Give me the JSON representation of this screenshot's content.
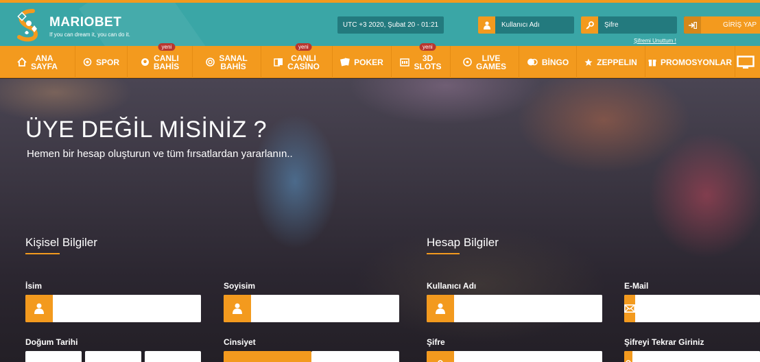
{
  "header": {
    "brand": "MARIOBET",
    "tagline": "If you can dream it, you can do it.",
    "datetime": "UTC +3 2020, Şubat 20 - 01:21",
    "username_placeholder": "Kullanıcı Adı",
    "password_placeholder": "Şifre",
    "forgot_link": "Şifremi Unuttum !",
    "login_button": "GİRİŞ YAP"
  },
  "nav": {
    "items": [
      {
        "label": "ANA\nSAYFA",
        "icon": "home-icon"
      },
      {
        "label": "SPOR",
        "icon": "target-icon"
      },
      {
        "label": "CANLI\nBAHİS",
        "icon": "ball-icon",
        "badge": "yeni"
      },
      {
        "label": "SANAL\nBAHİS",
        "icon": "chip-icon"
      },
      {
        "label": "CANLI\nCASİNO",
        "icon": "cards-icon",
        "badge": "yeni"
      },
      {
        "label": "POKER",
        "icon": "poker-cards-icon"
      },
      {
        "label": "3D\nSLOTS",
        "icon": "slot-icon",
        "badge": "yeni"
      },
      {
        "label": "LIVE\nGAMES",
        "icon": "roulette-icon"
      },
      {
        "label": "BİNGO",
        "icon": "bingo-icon"
      },
      {
        "label": "ZEPPELIN",
        "icon": "star-icon"
      },
      {
        "label": "PROMOSYONLAR",
        "icon": "gift-icon"
      }
    ]
  },
  "hero": {
    "title": "ÜYE DEĞİL MİSİNİZ ?",
    "subtitle": "Hemen bir hesap oluşturun ve tüm fırsatlardan yararlanın.."
  },
  "form": {
    "personal_title": "Kişisel Bilgiler",
    "account_title": "Hesap Bilgiler",
    "first_name_label": "İsim",
    "last_name_label": "Soyisim",
    "username_label": "Kullanıcı Adı",
    "email_label": "E-Mail",
    "birthdate_label": "Doğum Tarihi",
    "gender_label": "Cinsiyet",
    "password_label": "Şifre",
    "password_repeat_label": "Şifreyi Tekrar Giriniz"
  },
  "colors": {
    "accent": "#f39a1e",
    "header_teal": "#3aa6a6",
    "field_teal": "#237a7e"
  }
}
